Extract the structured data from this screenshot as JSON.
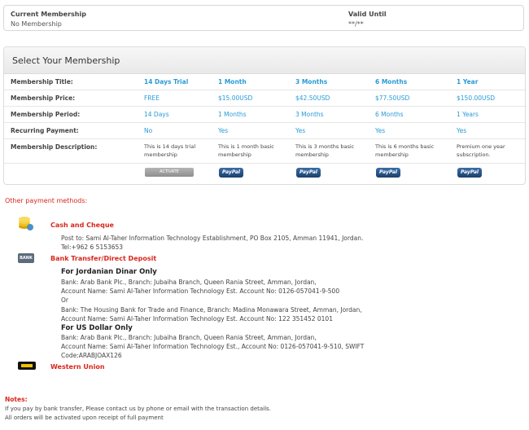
{
  "current": {
    "membership_label": "Current Membership",
    "membership_value": "No Membership",
    "valid_label": "Valid Until",
    "valid_value": "**/**"
  },
  "plans": {
    "heading": "Select Your Membership",
    "labels": {
      "title": "Membership Title:",
      "price": "Membership Price:",
      "period": "Membership Period:",
      "recurring": "Recurring Payment:",
      "description": "Membership Description:"
    },
    "columns": [
      {
        "title": "14 Days Trial",
        "price": "FREE",
        "period": "14 Days",
        "recurring": "No",
        "description": "This is 14 days trial membership",
        "action": "ACTIVATE"
      },
      {
        "title": "1 Month",
        "price": "$15.00USD",
        "period": "1 Months",
        "recurring": "Yes",
        "description": "This is 1 month basic membership",
        "action": "PayPal"
      },
      {
        "title": "3 Months",
        "price": "$42.50USD",
        "period": "3 Months",
        "recurring": "Yes",
        "description": "This is 3 months basic membership",
        "action": "PayPal"
      },
      {
        "title": "6 Months",
        "price": "$77.50USD",
        "period": "6 Months",
        "recurring": "Yes",
        "description": "This is 6 months basic membership",
        "action": "PayPal"
      },
      {
        "title": "1 Year",
        "price": "$150.00USD",
        "period": "1 Years",
        "recurring": "Yes",
        "description": "Premium one year subscription.",
        "action": "PayPal"
      }
    ]
  },
  "other_methods": {
    "heading": "Other payment methods:",
    "cash": {
      "heading": "Cash and Cheque",
      "line1": "Post to: Sami Al-Taher Information Technology Establishment, PO Box 2105, Amman 11941, Jordan.",
      "line2": "Tel:+962 6 5153653"
    },
    "bank": {
      "icon_text": "BANK",
      "heading": "Bank Transfer/Direct Deposit",
      "jod_heading": "For Jordanian Dinar Only",
      "jod_line1": "Bank: Arab Bank Plc., Branch: Jubaiha Branch, Queen Rania Street, Amman, Jordan,",
      "jod_line2": "Account Name: Sami Al-Taher Information Technology Est. Account No: 0126-057041-9-500",
      "or": "Or",
      "jod_line3": "Bank: The Housing Bank for Trade and Finance, Branch: Madina Monawara Street, Amman, Jordan,",
      "jod_line4": "Account Name: Sami Al-Taher Information Technology Est. Account No: 122 351452 0101",
      "usd_heading": "For US Dollar Only",
      "usd_line1": "Bank: Arab Bank Plc., Branch: Jubaiha Branch, Queen Rania Street, Amman, Jordan,",
      "usd_line2": "Account Name: Sami Al-Taher Information Technology Est., Account No: 0126-057041-9-510, SWIFT",
      "usd_line3": "Code:ARABJOAX126"
    },
    "western_union": {
      "heading": "Western Union"
    }
  },
  "notes": {
    "heading": "Notes:",
    "line1": "If you pay by bank transfer, Please contact us by phone or email with the transaction details.",
    "line2": "All orders will be activated upon receipt of full payment"
  },
  "colors": {
    "accent_blue": "#2a9bd6",
    "accent_red": "#d9261c",
    "paypal_blue": "#1b3f6c"
  }
}
